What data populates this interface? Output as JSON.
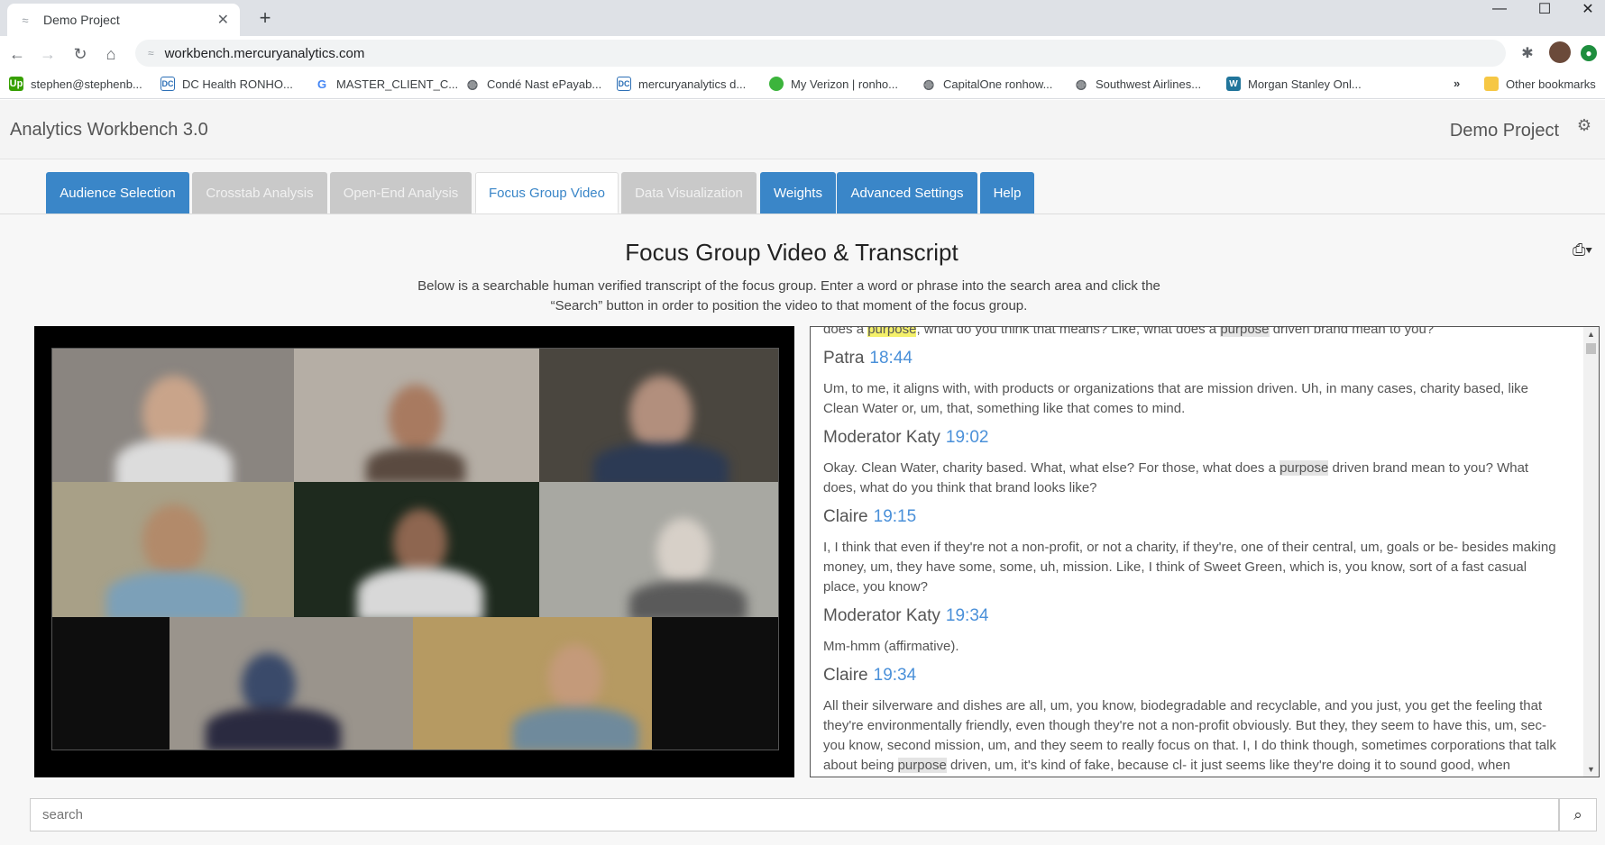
{
  "browser": {
    "tab_title": "Demo Project",
    "url": "workbench.mercuryanalytics.com",
    "bookmarks": [
      {
        "label": "stephen@stephenb...",
        "icon": "upwork-icon"
      },
      {
        "label": "DC Health RONHO...",
        "icon": "dc-logo-icon"
      },
      {
        "label": "MASTER_CLIENT_C...",
        "icon": "google-icon"
      },
      {
        "label": "Condé Nast ePayab...",
        "icon": "globe-icon"
      },
      {
        "label": "mercuryanalytics d...",
        "icon": "dc-logo-icon"
      },
      {
        "label": "My Verizon | ronho...",
        "icon": "verizon-icon"
      },
      {
        "label": "CapitalOne ronhow...",
        "icon": "globe-icon"
      },
      {
        "label": "Southwest Airlines...",
        "icon": "globe-icon"
      },
      {
        "label": "Morgan Stanley Onl...",
        "icon": "wordpress-icon"
      }
    ],
    "overflow_label": "»",
    "other_bookmarks": "Other bookmarks"
  },
  "app": {
    "title": "Analytics Workbench 3.0",
    "project": "Demo Project",
    "tabs": [
      {
        "label": "Audience Selection"
      },
      {
        "label": "Crosstab Analysis"
      },
      {
        "label": "Open-End Analysis"
      },
      {
        "label": "Focus Group Video"
      },
      {
        "label": "Data Visualization"
      },
      {
        "label": "Weights"
      },
      {
        "label": "Advanced Settings"
      },
      {
        "label": "Help"
      }
    ]
  },
  "page": {
    "heading": "Focus Group Video & Transcript",
    "description": "Below is a searchable human verified transcript of the focus group. Enter a word or phrase into the search area and click the “Search” button in order to position the video to that moment of the focus group."
  },
  "transcript": {
    "top_line_a": "does a ",
    "top_line_hl": "purpose",
    "top_line_b": ", what do you think that means? Like, what does a ",
    "top_line_hl2": "purpose",
    "top_line_c": " driven brand mean to you?",
    "entries": [
      {
        "speaker": "Patra",
        "time": "18:44",
        "text": "Um, to me, it aligns with, with products or organizations that are mission driven. Uh, in many cases, charity based, like Clean Water or, um, that, something like that comes to mind."
      },
      {
        "speaker": "Moderator Katy",
        "time": "19:02",
        "text_a": "Okay. Clean Water, charity based. What, what else? For those, what does a ",
        "text_hl": "purpose",
        "text_b": " driven brand mean to you? What does, what do you think that brand looks like?"
      },
      {
        "speaker": "Claire",
        "time": "19:15",
        "text": "I, I think that even if they're not a non-profit, or not a charity, if they're, one of their central, um, goals or be- besides making money, um, they have some, some, uh, mission. Like, I think of Sweet Green, which is, you know, sort of a fast casual place, you know?"
      },
      {
        "speaker": "Moderator Katy",
        "time": "19:34",
        "text": "Mm-hmm (affirmative)."
      },
      {
        "speaker": "Claire",
        "time": "19:34",
        "text_a": "All their silverware and dishes are all, um, you know, biodegradable and recyclable, and you just, you get the feeling that they're environmentally friendly, even though they're not a non-profit obviously. But they, they seem to have this, um, sec- you know, second mission, um, and they seem to really focus on that. I, I do think though, sometimes corporations that talk about being ",
        "text_hl": "purpose",
        "text_b": " driven, um, it's kind of fake, because cl- it just seems like they're doing it to sound good, when"
      }
    ]
  },
  "search": {
    "placeholder": "search"
  }
}
